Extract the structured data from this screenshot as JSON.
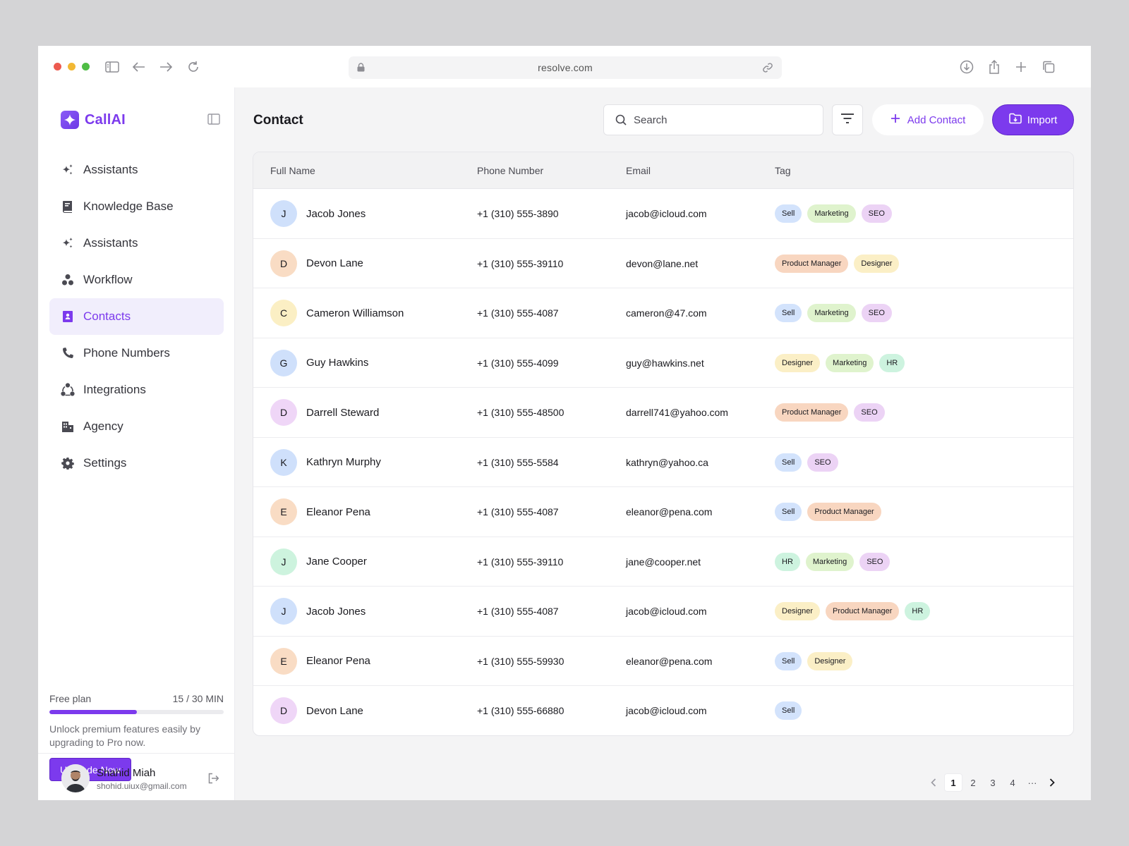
{
  "browser": {
    "url": "resolve.com"
  },
  "app": {
    "name": "CallAI"
  },
  "sidebar": {
    "items": [
      {
        "label": "Assistants",
        "icon": "sparkle-icon",
        "active": false
      },
      {
        "label": "Knowledge Base",
        "icon": "book-icon",
        "active": false
      },
      {
        "label": "Assistants",
        "icon": "sparkle-icon",
        "active": false
      },
      {
        "label": "Workflow",
        "icon": "workflow-icon",
        "active": false
      },
      {
        "label": "Contacts",
        "icon": "contacts-book-icon",
        "active": true
      },
      {
        "label": "Phone Numbers",
        "icon": "phone-icon",
        "active": false
      },
      {
        "label": "Integrations",
        "icon": "integrations-icon",
        "active": false
      },
      {
        "label": "Agency",
        "icon": "building-icon",
        "active": false
      },
      {
        "label": "Settings",
        "icon": "gear-icon",
        "active": false
      }
    ],
    "plan": {
      "name": "Free plan",
      "usage": "15 / 30 MIN",
      "progress": 0.5,
      "description": "Unlock premium features easily by upgrading to Pro now.",
      "upgrade_label": "Upgrade Now"
    },
    "user": {
      "name": "Shahid Miah",
      "email": "shohid.uiux@gmail.com"
    }
  },
  "main": {
    "title": "Contact",
    "search_placeholder": "Search",
    "add_label": "Add Contact",
    "import_label": "Import",
    "columns": [
      "Full Name",
      "Phone Number",
      "Email",
      "Tag"
    ],
    "rows": [
      {
        "initial": "J",
        "avatar_color": "#cfe0fb",
        "name": "Jacob Jones",
        "phone": "+1 (310) 555-3890",
        "email": "jacob@icloud.com",
        "tags": [
          "Sell",
          "Marketing",
          "SEO"
        ]
      },
      {
        "initial": "D",
        "avatar_color": "#f9dcc4",
        "name": "Devon Lane",
        "phone": "+1 (310) 555-39110",
        "email": "devon@lane.net",
        "tags": [
          "Product Manager",
          "Designer"
        ]
      },
      {
        "initial": "C",
        "avatar_color": "#fbefc4",
        "name": "Cameron Williamson",
        "phone": "+1 (310) 555-4087",
        "email": "cameron@47.com",
        "tags": [
          "Sell",
          "Marketing",
          "SEO"
        ]
      },
      {
        "initial": "G",
        "avatar_color": "#cfe0fb",
        "name": "Guy Hawkins",
        "phone": "+1 (310) 555-4099",
        "email": "guy@hawkins.net",
        "tags": [
          "Designer",
          "Marketing",
          "HR"
        ]
      },
      {
        "initial": "D",
        "avatar_color": "#efd6f7",
        "name": "Darrell Steward",
        "phone": "+1 (310) 555-48500",
        "email": "darrell741@yahoo.com",
        "tags": [
          "Product Manager",
          "SEO"
        ]
      },
      {
        "initial": "K",
        "avatar_color": "#cfe0fb",
        "name": "Kathryn Murphy",
        "phone": "+1 (310) 555-5584",
        "email": "kathryn@yahoo.ca",
        "tags": [
          "Sell",
          "SEO"
        ]
      },
      {
        "initial": "E",
        "avatar_color": "#f9dcc4",
        "name": "Eleanor Pena",
        "phone": "+1 (310) 555-4087",
        "email": "eleanor@pena.com",
        "tags": [
          "Sell",
          "Product Manager"
        ]
      },
      {
        "initial": "J",
        "avatar_color": "#cdf3de",
        "name": "Jane Cooper",
        "phone": "+1 (310) 555-39110",
        "email": "jane@cooper.net",
        "tags": [
          "HR",
          "Marketing",
          "SEO"
        ]
      },
      {
        "initial": "J",
        "avatar_color": "#cfe0fb",
        "name": "Jacob Jones",
        "phone": "+1 (310) 555-4087",
        "email": "jacob@icloud.com",
        "tags": [
          "Designer",
          "Product Manager",
          "HR"
        ]
      },
      {
        "initial": "E",
        "avatar_color": "#f9dcc4",
        "name": "Eleanor Pena",
        "phone": "+1 (310) 555-59930",
        "email": "eleanor@pena.com",
        "tags": [
          "Sell",
          "Designer"
        ]
      },
      {
        "initial": "D",
        "avatar_color": "#efd6f7",
        "name": "Devon Lane",
        "phone": "+1 (310) 555-66880",
        "email": "jacob@icloud.com",
        "tags": [
          "Sell"
        ]
      }
    ],
    "tag_colors": {
      "Sell": "#d3e3fc",
      "Marketing": "#dff3cd",
      "SEO": "#ecd3f5",
      "Product Manager": "#f8d6c0",
      "Designer": "#fbefc6",
      "HR": "#cdf3df"
    },
    "pagination": {
      "pages": [
        "1",
        "2",
        "3",
        "4"
      ],
      "current": "1",
      "more": "···"
    }
  },
  "colors": {
    "accent": "#7c3aed",
    "sidebar_active_bg": "#f1eefc"
  }
}
